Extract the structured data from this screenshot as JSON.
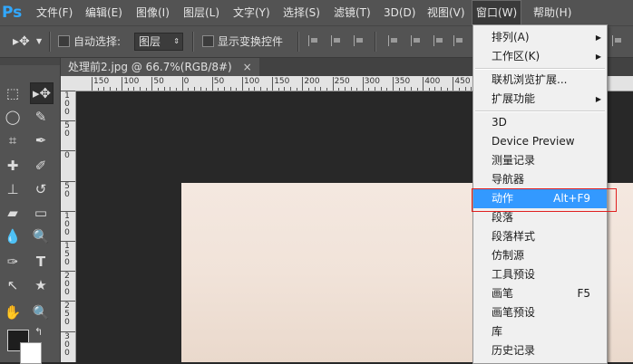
{
  "app": {
    "logo": "Ps"
  },
  "menubar": {
    "items": [
      {
        "label": "文件(F)"
      },
      {
        "label": "编辑(E)"
      },
      {
        "label": "图像(I)"
      },
      {
        "label": "图层(L)"
      },
      {
        "label": "文字(Y)"
      },
      {
        "label": "选择(S)"
      },
      {
        "label": "滤镜(T)"
      },
      {
        "label": "3D(D)"
      },
      {
        "label": "视图(V)"
      },
      {
        "label": "窗口(W)"
      },
      {
        "label": "帮助(H)"
      }
    ],
    "active": "窗口(W)"
  },
  "options": {
    "auto_select_label": "自动选择:",
    "auto_select_value": "图层",
    "auto_select_checked": false,
    "show_transform_label": "显示变换控件",
    "show_transform_checked": false
  },
  "document": {
    "tab_title": "处理前2.jpg @ 66.7%(RGB/8#)",
    "close_glyph": "×"
  },
  "ruler": {
    "h_labels": [
      "150",
      "100",
      "50",
      "0",
      "50",
      "100",
      "150",
      "200",
      "250",
      "300",
      "350",
      "400",
      "450"
    ],
    "v_labels": [
      "1\n0\n0",
      "5\n0",
      "0",
      "5\n0",
      "1\n0\n0",
      "1\n5\n0",
      "2\n0\n0",
      "2\n5\n0",
      "3\n0\n0"
    ]
  },
  "window_menu": {
    "items": [
      {
        "label": "排列(A)",
        "submenu": true
      },
      {
        "label": "工作区(K)",
        "submenu": true
      },
      {
        "label": "联机浏览扩展..."
      },
      {
        "label": "扩展功能",
        "submenu": true
      },
      {
        "label": "3D"
      },
      {
        "label": "Device Preview"
      },
      {
        "label": "测量记录"
      },
      {
        "label": "导航器"
      },
      {
        "label": "动作",
        "shortcut": "Alt+F9",
        "highlighted": true
      },
      {
        "label": "段落"
      },
      {
        "label": "段落样式"
      },
      {
        "label": "仿制源"
      },
      {
        "label": "工具预设"
      },
      {
        "label": "画笔",
        "shortcut": "F5"
      },
      {
        "label": "画笔预设"
      },
      {
        "label": "库"
      },
      {
        "label": "历史记录"
      }
    ],
    "submenu_arrow": "▶"
  },
  "colors": {
    "highlight": "#3399ff",
    "annotation_box": "#e02020",
    "ui_gray": "#535353"
  }
}
